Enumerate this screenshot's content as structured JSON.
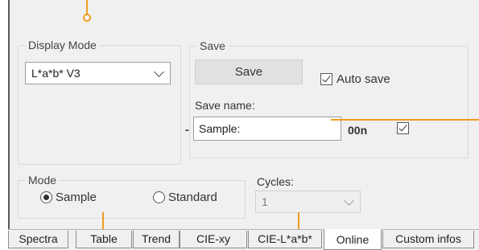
{
  "display_mode": {
    "legend": "Display Mode",
    "selected": "L*a*b* V3"
  },
  "save": {
    "legend": "Save",
    "button_label": "Save",
    "auto_save_label": "Auto save",
    "auto_save_checked": true,
    "name_label": "Save name:",
    "name_value": "Sample:",
    "prefix": "-",
    "suffix": "00n",
    "suffix_checked": true
  },
  "mode": {
    "legend": "Mode",
    "options": [
      {
        "label": "Sample",
        "selected": true
      },
      {
        "label": "Standard",
        "selected": false
      }
    ]
  },
  "cycles": {
    "label": "Cycles:",
    "value": "1"
  },
  "tabs": [
    {
      "label": "Spectra",
      "active": false
    },
    {
      "label": "Table",
      "active": false
    },
    {
      "label": "Trend",
      "active": false
    },
    {
      "label": "CIE-xy",
      "active": false
    },
    {
      "label": "CIE-L*a*b*",
      "active": false
    },
    {
      "label": "Online",
      "active": true
    },
    {
      "label": "Custom infos",
      "active": false
    }
  ],
  "colors": {
    "annotation": "#f29b1c",
    "panel_background": "#f0f0f0",
    "control_border": "#9e9e9e"
  },
  "icons": {
    "dropdown": "chevron-down-icon",
    "checkbox": "checkmark-icon",
    "radio": "radio-dot-icon"
  }
}
